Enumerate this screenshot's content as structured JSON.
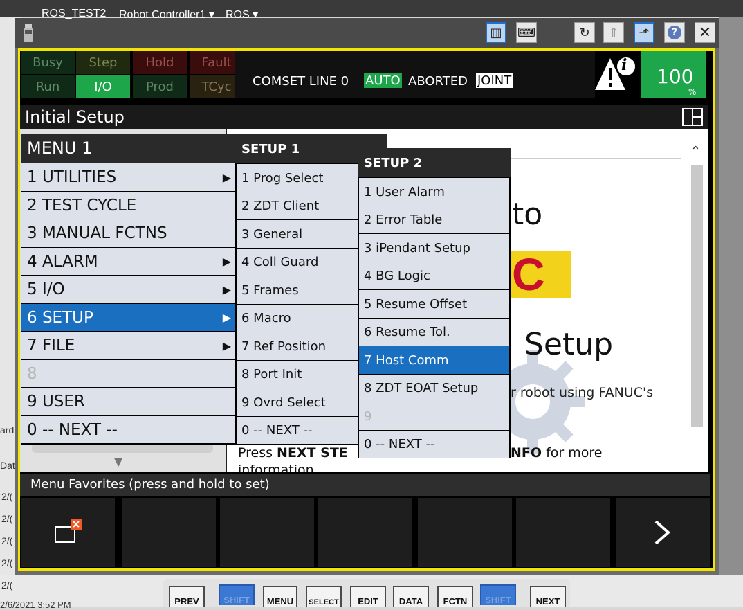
{
  "window": {
    "title": "ROS_TEST2",
    "controller": "Robot Controller1",
    "ros_menu": "ROS"
  },
  "status": {
    "row1": [
      "Busy",
      "Step",
      "Hold",
      "Fault"
    ],
    "row2": [
      "Run",
      "I/O",
      "Prod",
      "TCyc"
    ],
    "line": "COMSET LINE 0",
    "auto": "AUTO",
    "aborted": "ABORTED",
    "joint": "JOINT",
    "override": "100",
    "override_unit": "%",
    "info_glyph": "i"
  },
  "screen": {
    "title": "Initial Setup",
    "welcome_to": "to",
    "logo_fragment": "C",
    "setup_word": "Setup",
    "robot_text": "r robot using FANUC's",
    "press_next_prefix": "Press ",
    "press_next_bold": "NEXT STE",
    "info_bold": "NFO",
    "info_suffix": " for more",
    "information": "information"
  },
  "menu1": {
    "title": "MENU  1",
    "items": [
      "1 UTILITIES",
      "2 TEST CYCLE",
      "3 MANUAL FCTNS",
      "4 ALARM",
      "5 I/O",
      "6 SETUP",
      "7 FILE",
      "8",
      "9 USER",
      "0 -- NEXT --"
    ]
  },
  "setup1": {
    "title": "SETUP  1",
    "items": [
      "1 Prog Select",
      "2 ZDT Client",
      "3 General",
      "4 Coll Guard",
      "5 Frames",
      "6 Macro",
      "7 Ref Position",
      "8 Port Init",
      "9 Ovrd Select",
      "0 -- NEXT --"
    ]
  },
  "setup2": {
    "title": "SETUP  2",
    "items": [
      "1 User Alarm",
      "2 Error Table",
      "3 iPendant Setup",
      "4 BG Logic",
      "5 Resume Offset",
      "6 Resume Tol.",
      "7 Host Comm",
      "8 ZDT EOAT Setup",
      "9",
      "0 -- NEXT --"
    ]
  },
  "favorites": {
    "label": "Menu Favorites (press and hold to set)"
  },
  "hardkeys": [
    "PREV",
    "SHIFT",
    "MENU",
    "SELECT",
    "EDIT",
    "DATA",
    "FCTN",
    "SHIFT",
    "NEXT"
  ],
  "desktop": {
    "edge_texts": [
      "ard",
      "Dat",
      "2/(",
      "2/(",
      "2/(",
      "2/(",
      "2/(",
      "2/6/2021 3:52 PM"
    ]
  },
  "icons": {
    "pendant": "teach-pendant-icon",
    "keyboard": "keyboard-icon",
    "refresh": "refresh-icon",
    "jog": "jog-icon",
    "pop_out": "pop-out-icon",
    "help": "help-icon",
    "close": "close-icon",
    "split": "split-screen-icon",
    "warning": "warning-info-icon"
  },
  "colors": {
    "accent_blue": "#1a6fc0",
    "status_green": "#1da64a",
    "frame_yellow": "#f2e600"
  }
}
